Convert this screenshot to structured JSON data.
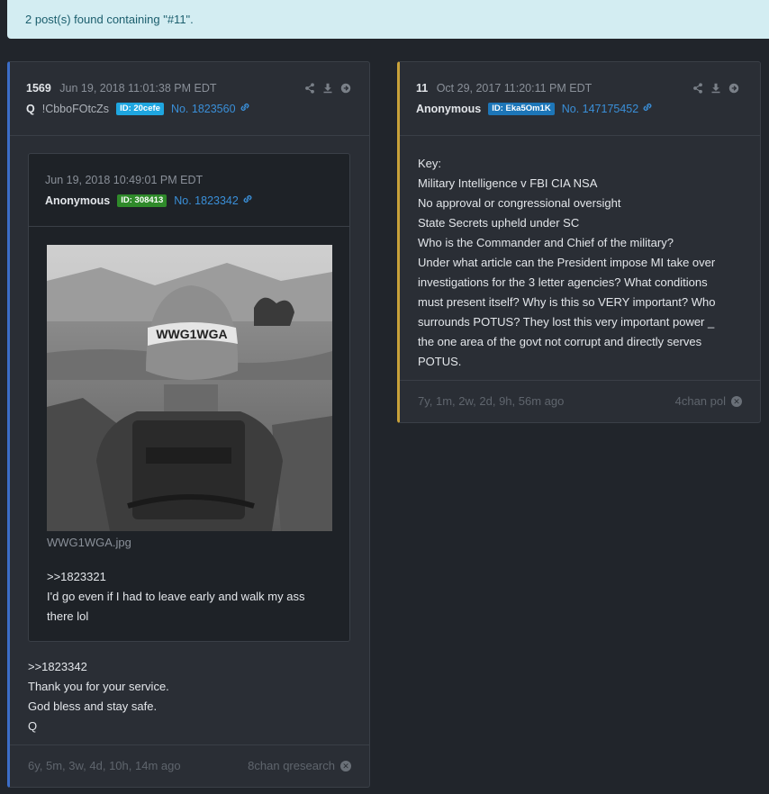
{
  "banner": {
    "text": "2 post(s) found containing \"#11\"."
  },
  "posts": [
    {
      "number": "1569",
      "date": "Jun 19, 2018 11:01:38 PM EDT",
      "name": "Q",
      "trip": "!CbboFOtcZs",
      "id_badge": "ID: 20cefe",
      "id_color": "#1fa6e0",
      "post_no": "No. 1823560",
      "quote": {
        "date": "Jun 19, 2018 10:49:01 PM EDT",
        "name": "Anonymous",
        "id_badge": "ID: 308413",
        "id_color": "#2f8a2a",
        "post_no": "No. 1823342",
        "image_text": "WWG1WGA",
        "filename": "WWG1WGA.jpg",
        "lines": [
          ">>1823321",
          "I'd go even if I had to leave early and walk my ass",
          "there lol"
        ]
      },
      "lines": [
        ">>1823342",
        "Thank you for your service.",
        "God bless and stay safe.",
        "Q"
      ],
      "ago": "6y, 5m, 3w, 4d, 10h, 14m ago",
      "source": "8chan qresearch"
    },
    {
      "number": "11",
      "date": "Oct 29, 2017 11:20:11 PM EDT",
      "name": "Anonymous",
      "id_badge": "ID: Eka5Om1K",
      "id_color": "#1d76b8",
      "post_no": "No. 147175452",
      "lines": [
        "Key:",
        "Military Intelligence v FBI CIA NSA",
        "No approval or congressional oversight",
        "State Secrets upheld under SC",
        "Who is the Commander and Chief of the military?",
        "Under what article can the President impose MI take over",
        "investigations for the 3 letter agencies? What conditions",
        "must present itself? Why is this so VERY important? Who",
        "surrounds POTUS? They lost this very important power _",
        "the one area of the govt not corrupt and directly serves",
        "POTUS."
      ],
      "ago": "7y, 1m, 2w, 2d, 9h, 56m ago",
      "source": "4chan pol"
    }
  ],
  "icons": [
    "share-icon",
    "download-icon",
    "arrow-right-circle-icon",
    "link-icon",
    "close-circle-icon"
  ]
}
